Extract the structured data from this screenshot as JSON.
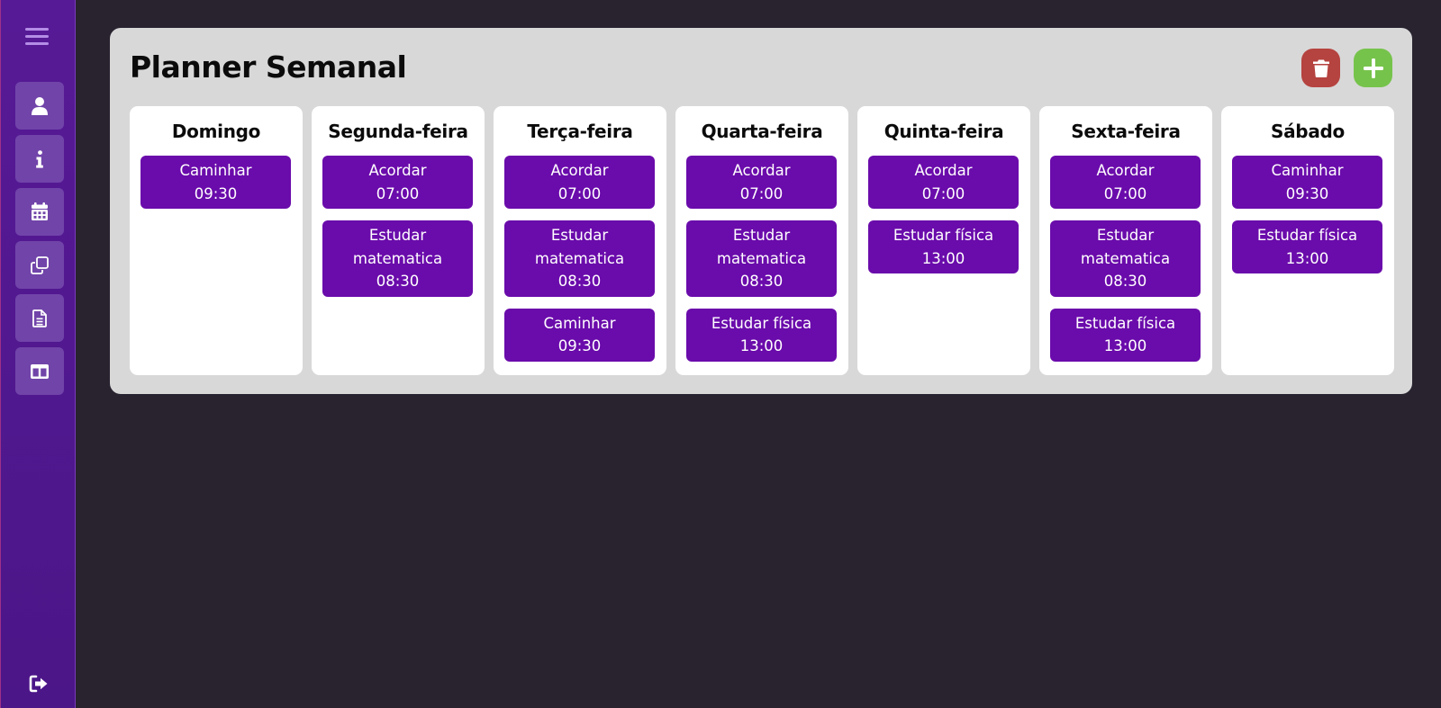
{
  "sidebar": {
    "nav_items": [
      {
        "icon": "user-icon"
      },
      {
        "icon": "info-icon"
      },
      {
        "icon": "calendar-icon"
      },
      {
        "icon": "copy-icon"
      },
      {
        "icon": "document-icon"
      },
      {
        "icon": "columns-icon"
      }
    ],
    "logout_icon": "logout-icon"
  },
  "planner": {
    "title": "Planner Semanal",
    "actions": {
      "delete_icon": "trash-icon",
      "add_icon": "plus-icon"
    },
    "days": [
      {
        "name": "Domingo",
        "tasks": [
          {
            "title_lines": [
              "Caminhar"
            ],
            "time": "09:30"
          }
        ]
      },
      {
        "name": "Segunda-feira",
        "tasks": [
          {
            "title_lines": [
              "Acordar"
            ],
            "time": "07:00"
          },
          {
            "title_lines": [
              "Estudar",
              "matematica"
            ],
            "time": "08:30"
          }
        ]
      },
      {
        "name": "Terça-feira",
        "tasks": [
          {
            "title_lines": [
              "Acordar"
            ],
            "time": "07:00"
          },
          {
            "title_lines": [
              "Estudar",
              "matematica"
            ],
            "time": "08:30"
          },
          {
            "title_lines": [
              "Caminhar"
            ],
            "time": "09:30"
          }
        ]
      },
      {
        "name": "Quarta-feira",
        "tasks": [
          {
            "title_lines": [
              "Acordar"
            ],
            "time": "07:00"
          },
          {
            "title_lines": [
              "Estudar",
              "matematica"
            ],
            "time": "08:30"
          },
          {
            "title_lines": [
              "Estudar física"
            ],
            "time": "13:00"
          }
        ]
      },
      {
        "name": "Quinta-feira",
        "tasks": [
          {
            "title_lines": [
              "Acordar"
            ],
            "time": "07:00"
          },
          {
            "title_lines": [
              "Estudar física"
            ],
            "time": "13:00"
          }
        ]
      },
      {
        "name": "Sexta-feira",
        "tasks": [
          {
            "title_lines": [
              "Acordar"
            ],
            "time": "07:00"
          },
          {
            "title_lines": [
              "Estudar",
              "matematica"
            ],
            "time": "08:30"
          },
          {
            "title_lines": [
              "Estudar física"
            ],
            "time": "13:00"
          }
        ]
      },
      {
        "name": "Sábado",
        "tasks": [
          {
            "title_lines": [
              "Caminhar"
            ],
            "time": "09:30"
          },
          {
            "title_lines": [
              "Estudar física"
            ],
            "time": "13:00"
          }
        ]
      }
    ]
  },
  "colors": {
    "background": "#28232f",
    "sidebar": "#571a96",
    "nav_item": "#7144a9",
    "panel": "#d8d8d8",
    "task": "#6a0bab",
    "delete": "#b5433f",
    "add": "#76c34b"
  }
}
